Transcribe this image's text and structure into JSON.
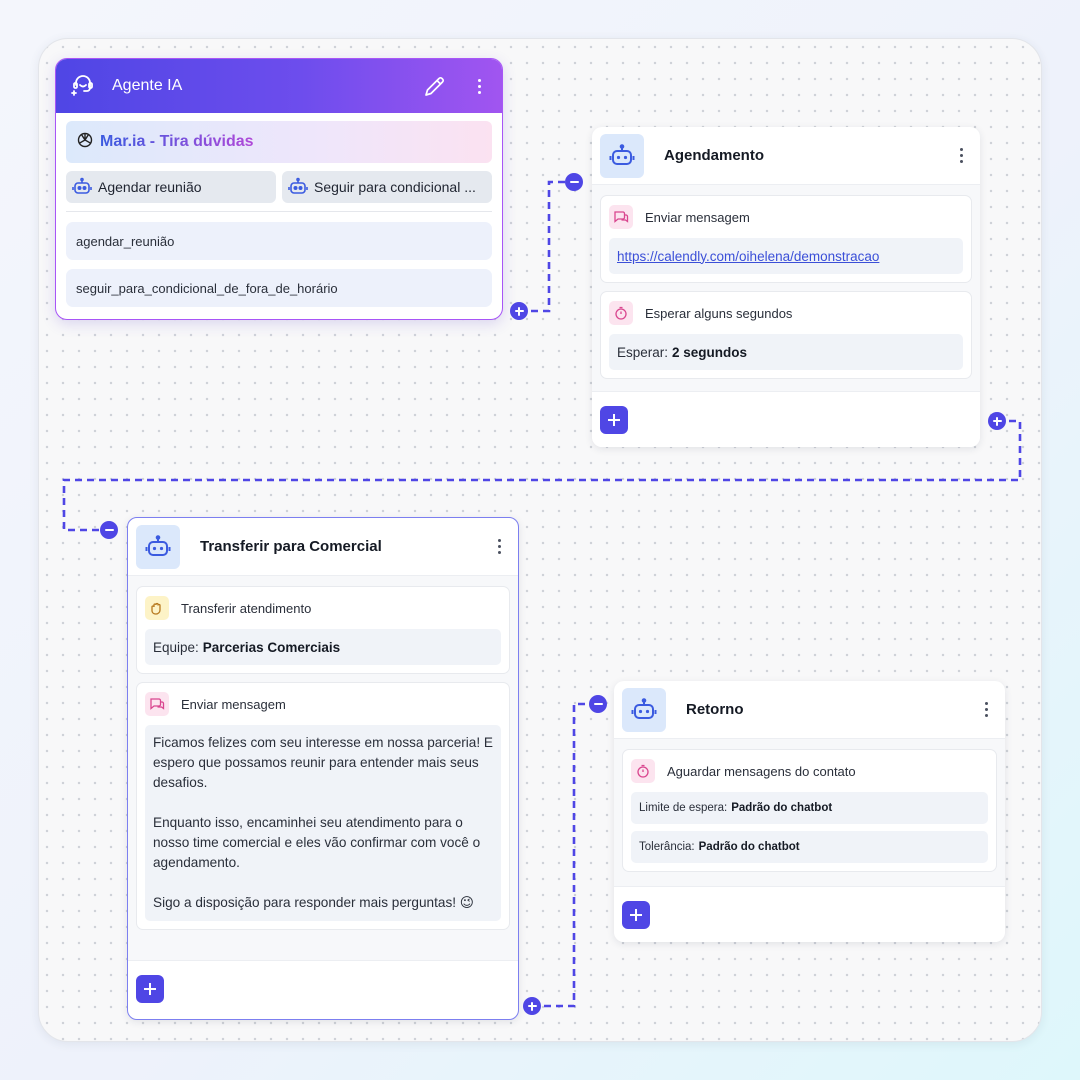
{
  "agent": {
    "title": "Agente IA",
    "model_name": "Mar.ia - Tira dúvidas",
    "chips": [
      "Agendar reunião",
      "Seguir para condicional ..."
    ],
    "functions": [
      "agendar_reunião",
      "seguir_para_condicional_de_fora_de_horário"
    ]
  },
  "agendamento": {
    "title": "Agendamento",
    "steps": [
      {
        "label": "Enviar mensagem",
        "icon": "chat-bubble-icon",
        "value": "https://calendly.com/oihelena/demonstracao"
      },
      {
        "label": "Esperar alguns segundos",
        "icon": "timer-icon",
        "value_label": "Esperar:",
        "value_bold": "2 segundos"
      }
    ]
  },
  "transferir": {
    "title": "Transferir para Comercial",
    "steps": [
      {
        "label": "Transferir atendimento",
        "icon": "handoff-icon",
        "value_label": "Equipe:",
        "value_bold": "Parcerias Comerciais"
      },
      {
        "label": "Enviar mensagem",
        "icon": "chat-bubble-icon",
        "paragraphs": [
          "Ficamos felizes com seu interesse em nossa parceria! E espero que possamos reunir para entender mais seus desafios.",
          "Enquanto isso, encaminhei seu atendimento para o nosso time comercial e eles vão confirmar com você o agendamento.",
          "Sigo a disposição para responder mais perguntas! 😉"
        ]
      }
    ]
  },
  "retorno": {
    "title": "Retorno",
    "steps": [
      {
        "label": "Aguardar mensagens do contato",
        "icon": "timer-icon",
        "rows": [
          {
            "label": "Limite de espera:",
            "value": "Padrão do chatbot"
          },
          {
            "label": "Tolerância:",
            "value": "Padrão do chatbot"
          }
        ]
      }
    ]
  },
  "colors": {
    "accent": "#4f46e5",
    "agent_gradient_end": "#a155f0",
    "icon_bg": "#dbe8fb",
    "canvas": "#f8f8f9"
  }
}
